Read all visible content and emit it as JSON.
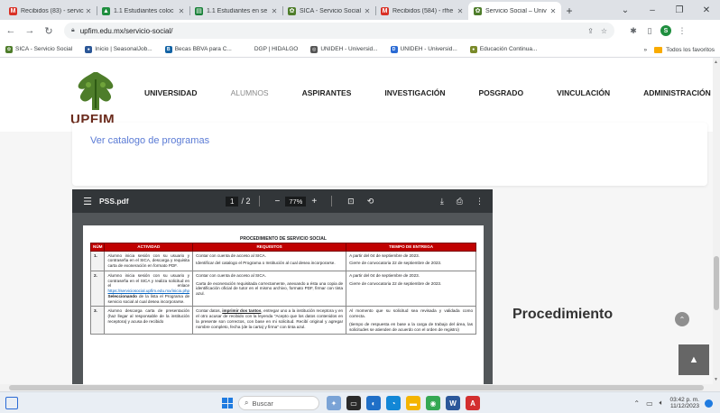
{
  "browser": {
    "tabs": [
      {
        "title": "Recibidos (83) - servic",
        "icon": "gmail-icon",
        "color": "#d93025",
        "glyph": "M",
        "active": false
      },
      {
        "title": "1.1 Estudiantes coloc",
        "icon": "drive-icon",
        "color": "#1e8e3e",
        "glyph": "▲",
        "active": false
      },
      {
        "title": "1.1 Estudiantes en se",
        "icon": "sheets-icon",
        "color": "#188038",
        "glyph": "▤",
        "active": false
      },
      {
        "title": "SICA - Servicio Social",
        "icon": "upfim-icon",
        "color": "#4e7d2a",
        "glyph": "✿",
        "active": false
      },
      {
        "title": "Recibidos (584) - rfhe",
        "icon": "gmail-icon",
        "color": "#d93025",
        "glyph": "M",
        "active": false
      },
      {
        "title": "Servicio Social – Univ",
        "icon": "upfim-icon",
        "color": "#4e7d2a",
        "glyph": "✿",
        "active": true
      }
    ],
    "url": "upfim.edu.mx/servicio-social/",
    "bookmarks": [
      {
        "label": "SICA - Servicio Social",
        "color": "#4e7d2a",
        "glyph": "✿"
      },
      {
        "label": "Inicio | SeasonalJob...",
        "color": "#2b5797",
        "glyph": "●"
      },
      {
        "label": "Becas BBVA para C...",
        "color": "#1464a5",
        "glyph": "B"
      },
      {
        "label": "DGP | HIDALGO",
        "color": "#ffffff",
        "glyph": ""
      },
      {
        "label": "UNIDEH - Universid...",
        "color": "#555555",
        "glyph": "◎"
      },
      {
        "label": "UNIDEH - Universid...",
        "color": "#2a6ad4",
        "glyph": "D"
      },
      {
        "label": "Educación Continua...",
        "color": "#7a8a2a",
        "glyph": "●"
      }
    ],
    "bookmarks_more": "»",
    "all_bookmarks": "Todos los favoritos",
    "profile_initial": "S"
  },
  "site": {
    "logo_text": "UPFIM",
    "nav": [
      "UNIVERSIDAD",
      "ALUMNOS",
      "ASPIRANTES",
      "INVESTIGACIÓN",
      "POSGRADO",
      "VINCULACIÓN",
      "ADMINISTRACIÓN"
    ],
    "catalog_link": "Ver catalogo de programas",
    "procedure_heading": "Procedimiento"
  },
  "pdf": {
    "filename": "PSS.pdf",
    "page_current": "1",
    "page_total": "/ 2",
    "zoom": "77%",
    "doc_title": "PROCEDIMIENTO DE SERVICIO SOCIAL",
    "headers": [
      "NÚM",
      "ACTIVIDAD",
      "REQUISITOS",
      "TIEMPO DE ENTREGA"
    ],
    "rows": [
      {
        "num": "1.",
        "actividad": "Alumno inicia sesión con su usuario y contraseña en el SICA, descarga y requisita carta de exoneración en formato PDF.",
        "requisitos_1": "Contar con cuenta de acceso al SICA.",
        "requisitos_2": "Identificar del catalogo el Programa o Institución al cual desea incorporarse.",
        "tiempo_1": "A partir del 04 de septiembre de 2023.",
        "tiempo_2": "Cierre de convocatoria 22 de septiembre de 2023."
      },
      {
        "num": "2.",
        "actividad_a": "Alumno inicia sesión con su usuario y contraseña en el SICA y realiza solicitud en el enlace",
        "actividad_link": "https://serviciosocial.upfim.edu.mx/inicio.php",
        "actividad_bold": "Seleccionando",
        "actividad_b": "de la lista el Programa de servicio social al cual desea incorporarse.",
        "requisitos_1": "Contar con cuenta de acceso al SICA.",
        "requisitos_2": "Carta de exoneración requisitada correctamente, anexando a ésta una copia de identificación oficial de tutor en el mismo archivo, formato PDF, firmar con tinta azul.",
        "tiempo_1": "A partir del 04 de septiembre de 2023.",
        "tiempo_2": "Cierre de convocatoria 22 de septiembre de 2023."
      },
      {
        "num": "3.",
        "actividad": "Alumno descarga carta de presentación (haz llegar al responsable de la institución receptora) y acusa de recibido",
        "requisitos_a": "Contar datos,",
        "requisitos_u": "imprimir dos tantos",
        "requisitos_b": ", entregar uno a la institución receptora y en el otro acusar de recibido con la leyenda \"Acepto que los datos contenidos en la presente son correctos, con base en mi solicitud. Recibí original y agregar nombre completo, fecha (de la carta) y firma\" con tinta azul.",
        "tiempo_1": "Al momento que su solicitud sea revisada y validada como correcta.",
        "tiempo_2": "(tiempo de respuesta en base a la carga de trabajo del área, las solicitudes se atienden de acuerdo con el orden de registro)"
      }
    ]
  },
  "taskbar": {
    "search_placeholder": "Buscar",
    "time": "03:42 p. m.",
    "date": "11/12/2023"
  }
}
